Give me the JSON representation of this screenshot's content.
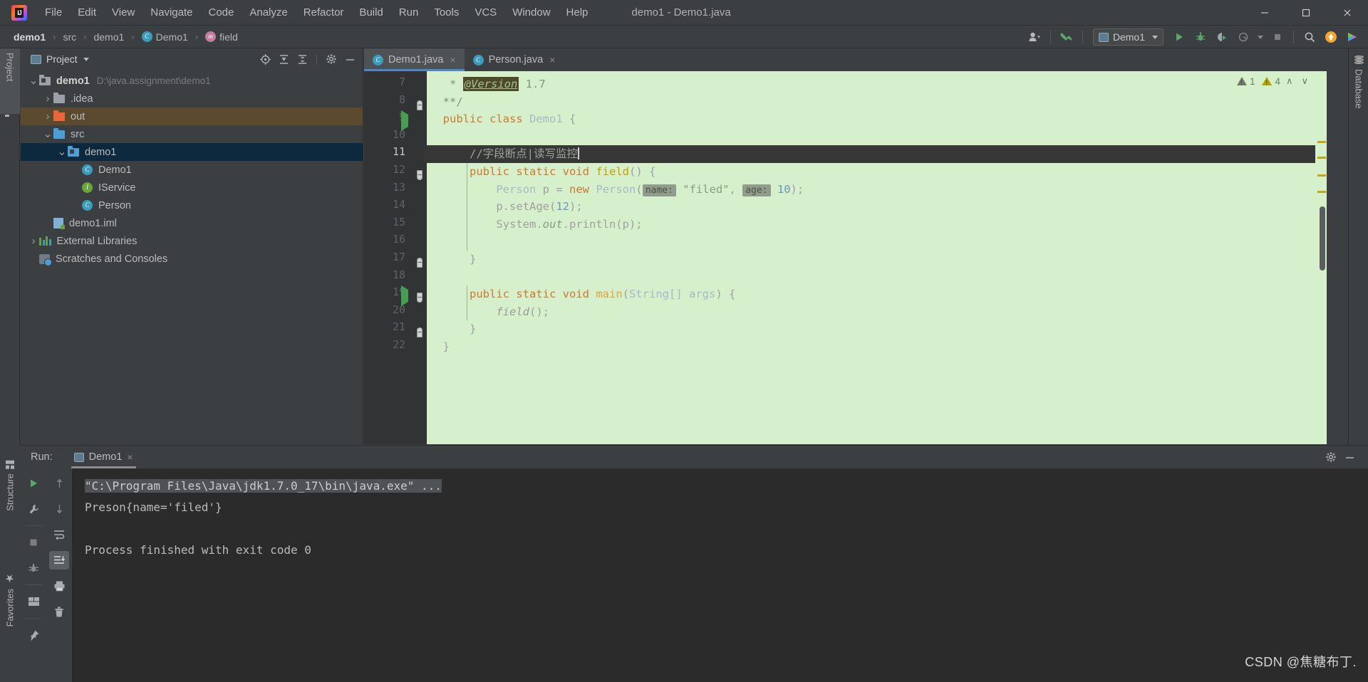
{
  "window": {
    "title": "demo1 - Demo1.java",
    "logo_text": "IJ",
    "controls": {
      "minimize": "minimize-icon",
      "maximize": "maximize-icon",
      "close": "close-icon"
    }
  },
  "menubar": {
    "items": [
      {
        "label": "File"
      },
      {
        "label": "Edit"
      },
      {
        "label": "View"
      },
      {
        "label": "Navigate"
      },
      {
        "label": "Code"
      },
      {
        "label": "Analyze"
      },
      {
        "label": "Refactor"
      },
      {
        "label": "Build"
      },
      {
        "label": "Run"
      },
      {
        "label": "Tools"
      },
      {
        "label": "VCS"
      },
      {
        "label": "Window"
      },
      {
        "label": "Help"
      }
    ]
  },
  "breadcrumb": {
    "items": [
      {
        "label": "demo1",
        "icon": "",
        "bold": true
      },
      {
        "label": "src",
        "icon": ""
      },
      {
        "label": "demo1",
        "icon": ""
      },
      {
        "label": "Demo1",
        "icon": "class-icon"
      },
      {
        "label": "field",
        "icon": "method-icon"
      }
    ]
  },
  "toolbar": {
    "account_icon": "user-account-icon",
    "update_icon": "vcs-update-icon",
    "run_config_label": "Demo1",
    "run_icon": "run-icon",
    "debug_icon": "debug-icon",
    "run_coverage_icon": "run-with-coverage-icon",
    "profile_icon": "profiler-icon",
    "stop_icon": "stop-icon",
    "search_icon": "search-everywhere-icon",
    "updates_icon": "ide-update-badge-icon",
    "preview_icon": "preview-icon"
  },
  "left_strip": {
    "project_tab": "Project"
  },
  "right_strip": {
    "database_tab": "Database"
  },
  "bottom_left_strip": {
    "structure_tab": "Structure",
    "favorites_tab": "Favorites"
  },
  "project_panel": {
    "title": "Project",
    "tools": [
      {
        "name": "locate-icon"
      },
      {
        "name": "expand-all-icon"
      },
      {
        "name": "collapse-all-icon"
      },
      {
        "name": "settings-gear-icon"
      },
      {
        "name": "hide-icon"
      }
    ],
    "tree": [
      {
        "label": "demo1",
        "path": "D:\\java.assignment\\demo1",
        "arrow": "v",
        "indent": 0,
        "icon": "module-folder",
        "bold": true,
        "state": ""
      },
      {
        "label": ".idea",
        "path": "",
        "arrow": ">",
        "indent": 1,
        "icon": "folder-grey",
        "bold": false,
        "state": ""
      },
      {
        "label": "out",
        "path": "",
        "arrow": ">",
        "indent": 1,
        "icon": "folder-orange",
        "bold": false,
        "state": "highlight"
      },
      {
        "label": "src",
        "path": "",
        "arrow": "v",
        "indent": 1,
        "icon": "folder-blue",
        "bold": false,
        "state": ""
      },
      {
        "label": "demo1",
        "path": "",
        "arrow": "v",
        "indent": 2,
        "icon": "package-folder",
        "bold": false,
        "state": "sel"
      },
      {
        "label": "Demo1",
        "path": "",
        "arrow": "",
        "indent": 3,
        "icon": "class-runnable-icon",
        "bold": false,
        "state": ""
      },
      {
        "label": "IService",
        "path": "",
        "arrow": "",
        "indent": 3,
        "icon": "interface-icon",
        "bold": false,
        "state": ""
      },
      {
        "label": "Person",
        "path": "",
        "arrow": "",
        "indent": 3,
        "icon": "class-icon",
        "bold": false,
        "state": ""
      },
      {
        "label": "demo1.iml",
        "path": "",
        "arrow": "",
        "indent": 1,
        "icon": "iml-file-icon",
        "bold": false,
        "state": ""
      },
      {
        "label": "External Libraries",
        "path": "",
        "arrow": ">",
        "indent": 0,
        "icon": "libraries-icon",
        "bold": false,
        "state": ""
      },
      {
        "label": "Scratches and Consoles",
        "path": "",
        "arrow": "",
        "indent": 0,
        "icon": "scratches-icon",
        "bold": false,
        "state": ""
      }
    ]
  },
  "editor": {
    "tabs": [
      {
        "label": "Demo1.java",
        "icon": "class-runnable-icon",
        "active": true,
        "close": "×"
      },
      {
        "label": "Person.java",
        "icon": "class-icon",
        "active": false,
        "close": "×"
      }
    ],
    "first_line_number": 7,
    "lines": [
      {
        "n": 7,
        "caret": false,
        "gutter": "",
        "fold": "",
        "html": "   <span class=\"tk-doc\">* </span><span class=\"tk-anno\">@Version</span><span class=\"tk-doc\"> 1.7</span>"
      },
      {
        "n": 8,
        "caret": false,
        "gutter": "",
        "fold": "up",
        "html": "  <span class=\"tk-doc\">**/</span>"
      },
      {
        "n": 9,
        "caret": false,
        "gutter": "run",
        "fold": "",
        "html": "  <span class=\"tk-kw\">public class</span> <span class=\"tk-cls\">Demo1</span> <span class=\"tk-txt\">{</span>"
      },
      {
        "n": 10,
        "caret": false,
        "gutter": "",
        "fold": "",
        "html": ""
      },
      {
        "n": 11,
        "caret": true,
        "gutter": "",
        "fold": "",
        "html": "      <span class=\"tk-cmt\">//字段断点|读写监控</span><span class=\"caret\"></span>"
      },
      {
        "n": 12,
        "caret": false,
        "gutter": "",
        "fold": "down",
        "html": "      <span class=\"tk-kw\">public static void</span> <span class=\"tk-mtd\">field</span><span class=\"tk-txt\">() {</span>"
      },
      {
        "n": 13,
        "caret": false,
        "gutter": "",
        "fold": "",
        "html": "          <span class=\"tk-cls\">Person</span> <span class=\"tk-txt\">p =</span> <span class=\"tk-kw\">new</span> <span class=\"tk-cls\">Person</span><span class=\"tk-txt\">(</span><span class=\"hint\">name:</span> <span class=\"tk-str\">\"filed\"</span><span class=\"tk-txt\">,</span> <span class=\"hint\">age:</span> <span class=\"tk-num\">10</span><span class=\"tk-txt\">);</span>"
      },
      {
        "n": 14,
        "caret": false,
        "gutter": "",
        "fold": "",
        "html": "          <span class=\"tk-txt\">p.setAge(</span><span class=\"tk-num\">12</span><span class=\"tk-txt\">);</span>"
      },
      {
        "n": 15,
        "caret": false,
        "gutter": "",
        "fold": "",
        "html": "          <span class=\"tk-txt\">System.</span><span class=\"tk-stat\">out</span><span class=\"tk-txt\">.println(p);</span>"
      },
      {
        "n": 16,
        "caret": false,
        "gutter": "",
        "fold": "",
        "html": ""
      },
      {
        "n": 17,
        "caret": false,
        "gutter": "",
        "fold": "up",
        "html": "      <span class=\"tk-txt\">}</span>"
      },
      {
        "n": 18,
        "caret": false,
        "gutter": "",
        "fold": "",
        "html": ""
      },
      {
        "n": 19,
        "caret": false,
        "gutter": "run",
        "fold": "down",
        "html": "      <span class=\"tk-kw\">public static void</span> <span class=\"tk-mtd2\">main</span><span class=\"tk-txt\">(</span><span class=\"tk-cls\">String[] args</span><span class=\"tk-txt\">) {</span>"
      },
      {
        "n": 20,
        "caret": false,
        "gutter": "",
        "fold": "",
        "html": "          <span class=\"tk-italic\">field</span><span class=\"tk-txt\">();</span>"
      },
      {
        "n": 21,
        "caret": false,
        "gutter": "",
        "fold": "up",
        "html": "      <span class=\"tk-txt\">}</span>"
      },
      {
        "n": 22,
        "caret": false,
        "gutter": "",
        "fold": "",
        "html": "  <span class=\"tk-txt\">}</span>"
      }
    ],
    "inspections": {
      "grey_count": "1",
      "warning_count": "4",
      "up_chevron": "∧",
      "down_chevron": "∨"
    }
  },
  "run_panel": {
    "label": "Run:",
    "tab_label": "Demo1",
    "tab_icon": "run-config-icon",
    "close": "×",
    "settings_icon": "settings-gear-icon",
    "hide_icon": "hide-icon",
    "tools_left": [
      {
        "name": "rerun-icon"
      },
      {
        "name": "wrench-settings-icon"
      },
      {
        "name": "stop-icon"
      },
      {
        "name": "debug-attach-icon"
      },
      {
        "name": "layout-icon"
      },
      {
        "name": "pin-icon"
      }
    ],
    "tools_right": [
      {
        "name": "arrow-up-icon"
      },
      {
        "name": "arrow-down-icon"
      },
      {
        "name": "soft-wrap-icon"
      },
      {
        "name": "scroll-to-end-icon"
      },
      {
        "name": "print-icon"
      },
      {
        "name": "clear-all-icon"
      }
    ],
    "console_lines": [
      {
        "text": "\"C:\\Program Files\\Java\\jdk1.7.0_17\\bin\\java.exe\" ...",
        "selected": true
      },
      {
        "text": "Preson{name='filed'}",
        "selected": false
      },
      {
        "text": "",
        "selected": false
      },
      {
        "text": "Process finished with exit code 0",
        "selected": false
      }
    ]
  },
  "watermark": {
    "text": "CSDN @焦糖布丁."
  },
  "colors": {
    "chrome": "#3c3f41",
    "editor_bg": "#d6f0cc",
    "console_bg": "#2b2b2b",
    "accent_blue": "#4a88c7",
    "selection_blue": "#0d293e",
    "run_green": "#499c54",
    "warning_yellow": "#b0a000"
  }
}
